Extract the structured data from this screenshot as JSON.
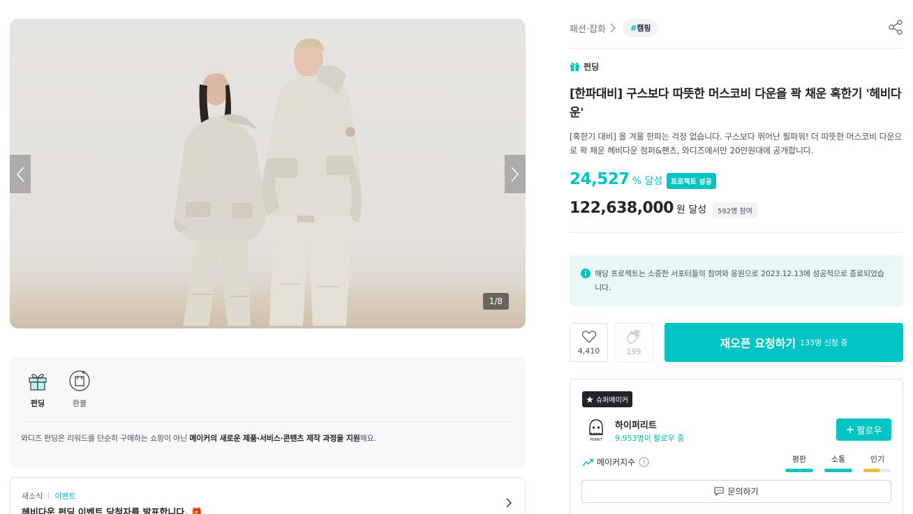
{
  "gallery": {
    "counter": "1/8",
    "prev_icon": "chevron-left-icon",
    "next_icon": "chevron-right-icon"
  },
  "info_card": {
    "tabs": [
      {
        "label": "펀딩",
        "icon": "gift-icon",
        "active": true
      },
      {
        "label": "환불",
        "icon": "refund-box-icon",
        "active": false
      }
    ],
    "text_prefix": "와디즈 펀딩은 리워드를 단순히 구매하는 쇼핑이 아닌 ",
    "text_bold": "메이커의 새로운 제품·서비스·콘텐츠 제작 과정을 지원",
    "text_suffix": "해요."
  },
  "news": {
    "category": "새소식",
    "tag": "이벤트",
    "title": "헤비다운 펀딩 이벤트 당첨자를 발표합니다. 🎁"
  },
  "breadcrumb": {
    "category": "패션·잡화",
    "hashtag_symbol": "#",
    "hashtag": "캠핑"
  },
  "project": {
    "type_label": "펀딩",
    "title": "[한파대비] 구스보다 따뜻한 머스코비 다운을 꽉 채운 혹한기 '헤비다운'",
    "description": "[혹한기 대비] 올 겨울 한파는 걱정 없습니다. 구스보다 뛰어난 필파워! 더 따뜻한 머스코비 다운으로 꽉 채운 헤비다운 점퍼&팬츠, 와디즈에서만 20만원대에 공개합니다.",
    "achievement_rate": "24,527",
    "achievement_unit": "% 달성",
    "success_badge": "프로젝트 성공",
    "amount": "122,638,000",
    "amount_unit": "원 달성",
    "supporters": "592명 참여"
  },
  "notice": {
    "text": "해당 프로젝트는 소중한 서포터들의 참여와 응원으로 2023.12.13에 성공적으로 종료되었습니다."
  },
  "actions": {
    "like_count": "4,410",
    "cheer_count": "199",
    "reopen_label": "재오픈 요청하기",
    "reopen_count": "133명 신청 중"
  },
  "maker": {
    "badge": "슈퍼메이커",
    "logo_text": "PERRIT",
    "name": "하이퍼리트",
    "followers": "9,953명이 팔로우 중",
    "follow_label": "팔로우",
    "index_label": "메이커지수",
    "metrics": [
      {
        "label": "평판",
        "level": 1.0,
        "color": "#00c4c4"
      },
      {
        "label": "소통",
        "level": 1.0,
        "color": "#00c4c4"
      },
      {
        "label": "인기",
        "level": 0.6,
        "color": "#f5b841"
      }
    ],
    "inquiry_label": "문의하기"
  }
}
